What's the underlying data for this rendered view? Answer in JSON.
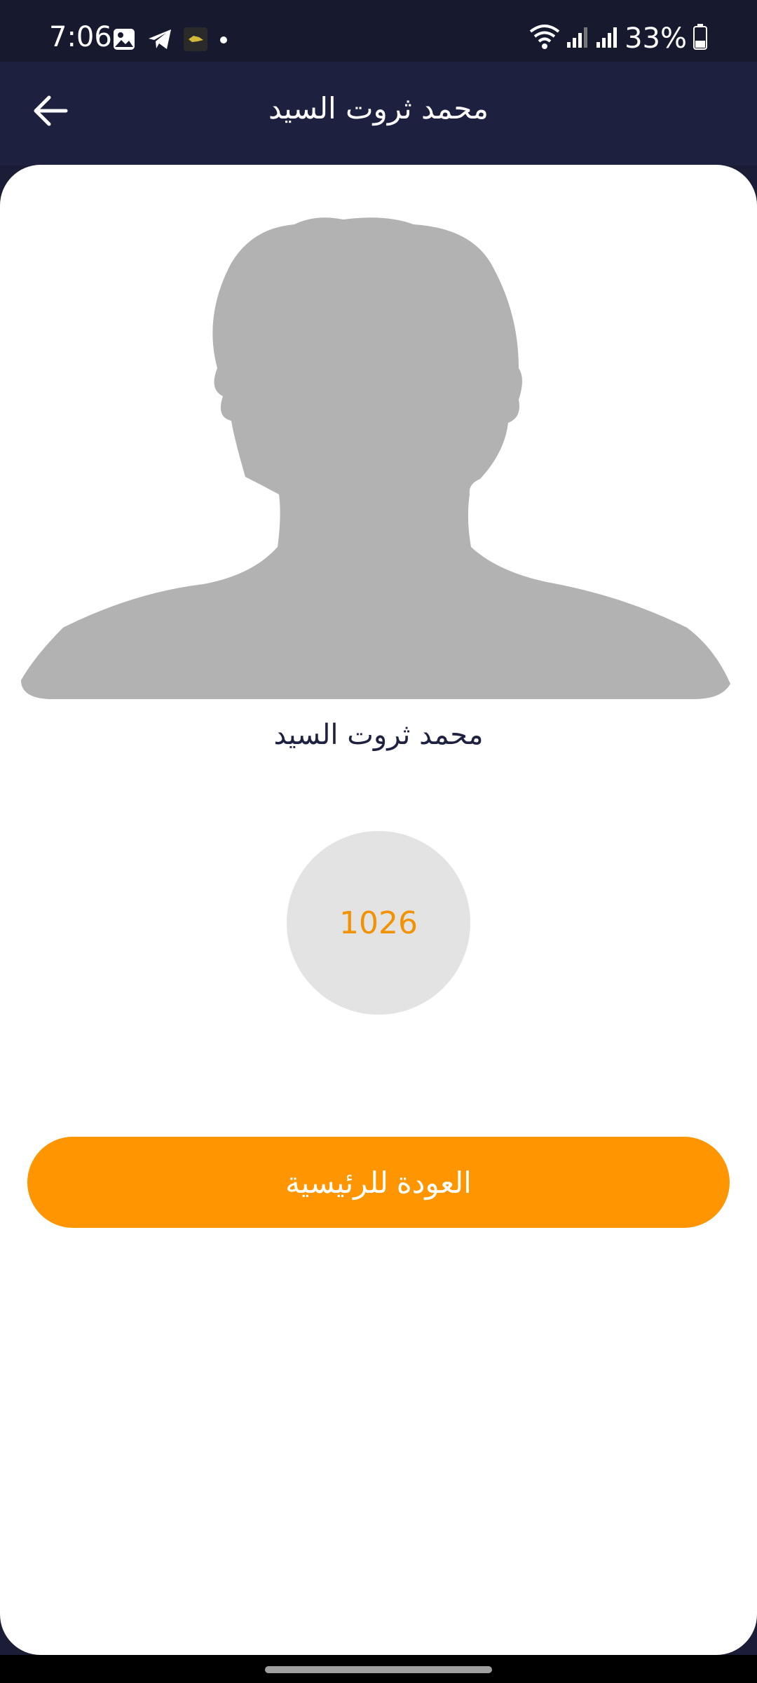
{
  "status_bar": {
    "time": "7:06",
    "battery": "33%",
    "icons_left": [
      "image-icon",
      "telegram-icon",
      "app-icon",
      "dot-icon"
    ],
    "icons_right": [
      "wifi-icon",
      "signal-icon",
      "signal-icon",
      "battery-icon"
    ]
  },
  "app_bar": {
    "title": "محمد ثروت السيد",
    "back_icon": "arrow-left-icon"
  },
  "profile": {
    "name": "محمد ثروت السيد",
    "points": "1026",
    "avatar_icon": "person-silhouette-icon"
  },
  "actions": {
    "home_label": "العودة للرئيسية"
  },
  "colors": {
    "header": "#1e2040",
    "accent": "#ff9500",
    "points_text": "#f39200",
    "avatar": "#b2b2b3"
  }
}
